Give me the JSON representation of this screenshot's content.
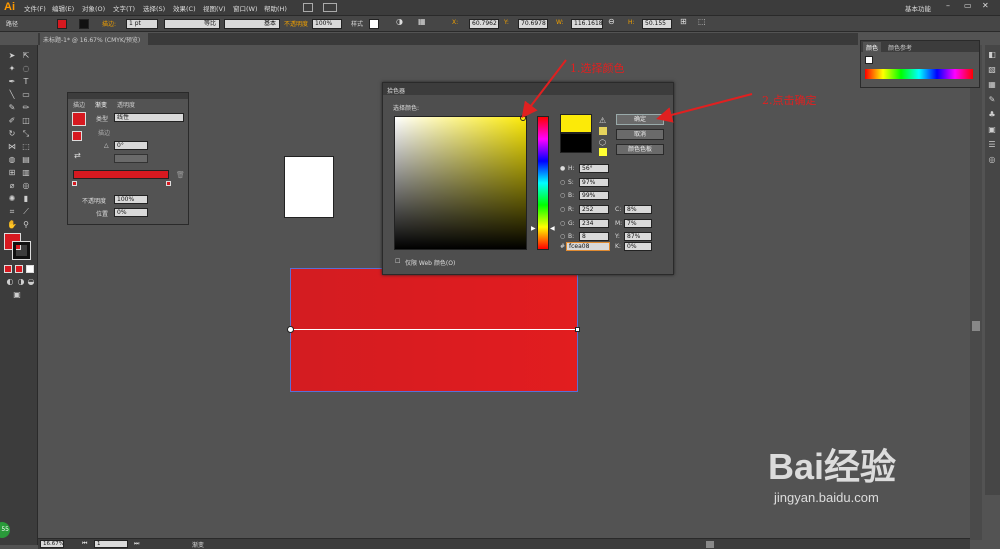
{
  "app": {
    "logo": "Ai",
    "menu": [
      "文件(F)",
      "编辑(E)",
      "对象(O)",
      "文字(T)",
      "选择(S)",
      "效果(C)",
      "视图(V)",
      "窗口(W)",
      "帮助(H)"
    ],
    "workspace": "基本功能"
  },
  "controlbar": {
    "path_label": "路径",
    "stroke_label": "描边:",
    "stroke_value": "1 pt",
    "profile_label": "等比",
    "brush_label": "基本",
    "opacity_label": "不透明度",
    "opacity_value": "100%",
    "style_label": "样式",
    "x_value": "60.7962",
    "y_value": "70.6978",
    "w_value": "116.1618",
    "h_value": "50.155"
  },
  "document": {
    "tab_title": "未标题-1* @ 16.67% (CMYK/预览)"
  },
  "gradient_panel": {
    "tabs": [
      "描边",
      "渐变",
      "透明度"
    ],
    "type_label": "类型",
    "type_value": "线性",
    "stroke_label": "描边",
    "angle_value": "0°",
    "opacity_label": "不透明度",
    "opacity_value": "100%",
    "position_label": "位置",
    "position_value": "0%",
    "colors": {
      "fill": "#d71920",
      "gradient_start": "#d71920",
      "gradient_end": "#d71920"
    }
  },
  "color_panel": {
    "tabs": [
      "颜色",
      "颜色参考"
    ]
  },
  "color_picker": {
    "title": "拾色器",
    "select_label": "选择颜色:",
    "ok_label": "确定",
    "cancel_label": "取消",
    "swatches_label": "颜色色板",
    "h_label": "H:",
    "h_value": "56°",
    "s_label": "S:",
    "s_value": "97%",
    "b_label": "B:",
    "b_value": "99%",
    "r_label": "R:",
    "r_value": "252",
    "g_label": "G:",
    "g_value": "234",
    "bb_label": "B:",
    "bb_value": "8",
    "hex_label": "#",
    "hex_value": "fcea08",
    "c_label": "C:",
    "c_value": "8%",
    "m_label": "M:",
    "m_value": "7%",
    "y_label": "Y:",
    "y_value": "87%",
    "k_label": "K:",
    "k_value": "0%",
    "web_only_label": "仅限 Web 颜色(O)",
    "new_color": "#fcea08",
    "old_color": "#000000"
  },
  "annotations": {
    "step1": "1.选择颜色",
    "step2": "2.点击确定",
    "color": "#e02020"
  },
  "statusbar": {
    "zoom": "16.67%",
    "page": "1",
    "tool": "渐变"
  },
  "watermark": {
    "brand": "Bai经验",
    "url": "jingyan.baidu.com"
  },
  "canvas": {
    "artboard_color": "#ffffff",
    "rect_color": "#dc1c20"
  }
}
